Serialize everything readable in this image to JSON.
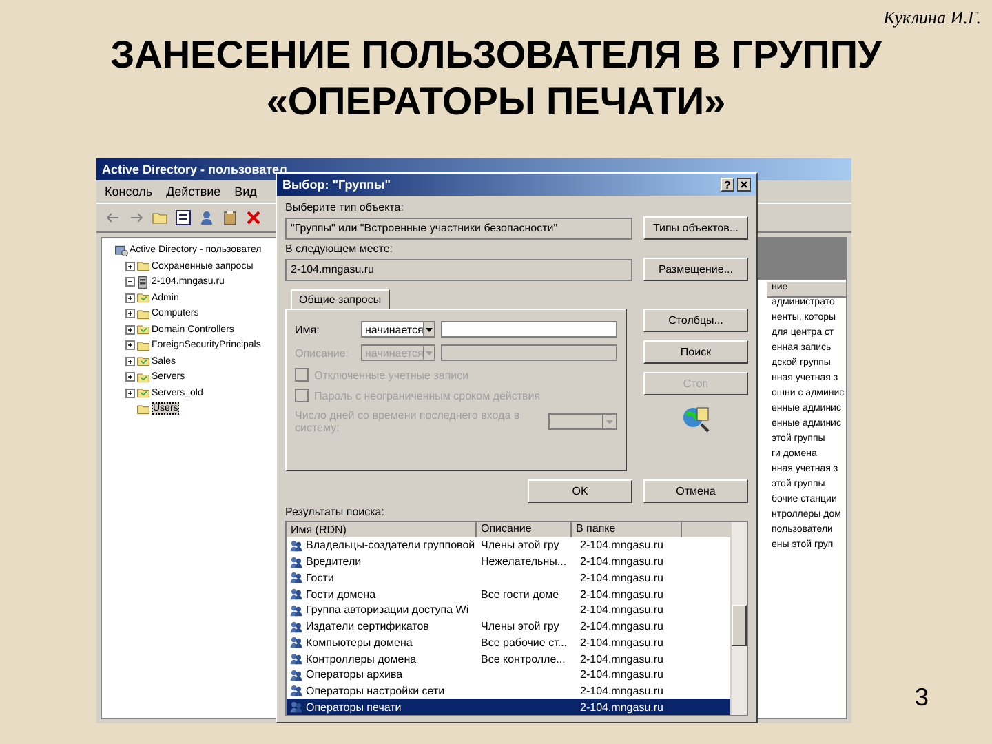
{
  "slide": {
    "author": "Куклина И.Г.",
    "title": "ЗАНЕСЕНИЕ ПОЛЬЗОВАТЕЛЯ В ГРУППУ «ОПЕРАТОРЫ ПЕЧАТИ»",
    "page_number": "3"
  },
  "ad_window": {
    "title": "Active Directory - пользовател",
    "menu": [
      "Консоль",
      "Действие",
      "Вид"
    ],
    "tree": [
      {
        "label": "Active Directory - пользовател",
        "kind": "root",
        "selected": false,
        "children": [
          {
            "label": "Сохраненные запросы",
            "kind": "container",
            "expanded": false,
            "selected": false
          },
          {
            "label": "2-104.mngasu.ru",
            "kind": "domain",
            "expanded": true,
            "selected": false,
            "children": [
              {
                "label": "Admin",
                "kind": "ou",
                "expanded": false,
                "selected": false
              },
              {
                "label": "Computers",
                "kind": "container",
                "expanded": false,
                "selected": false
              },
              {
                "label": "Domain Controllers",
                "kind": "ou",
                "expanded": false,
                "selected": false
              },
              {
                "label": "ForeignSecurityPrincipals",
                "kind": "container",
                "expanded": false,
                "selected": false
              },
              {
                "label": "Sales",
                "kind": "ou",
                "expanded": false,
                "selected": false
              },
              {
                "label": "Servers",
                "kind": "ou",
                "expanded": false,
                "selected": false
              },
              {
                "label": "Servers_old",
                "kind": "ou",
                "expanded": false,
                "selected": false
              },
              {
                "label": "Users",
                "kind": "container",
                "selected": true
              }
            ]
          }
        ]
      }
    ],
    "list_header": "ние",
    "list_lines": [
      "администрато",
      "ненты, которы",
      "для центра ст",
      "енная запись",
      "дской группы",
      "нная учетная з",
      "ошни с админис",
      "енные админис",
      "енные админис",
      "этой группы",
      "ги домена",
      "нная учетная з",
      "этой группы",
      "бочие станции",
      "нтроллеры дом",
      "пользователи",
      "ены этой груп"
    ]
  },
  "dialog": {
    "title": "Выбор: \"Группы\"",
    "help": "?",
    "type_label": "Выберите тип объекта:",
    "type_value": "\"Группы\" или \"Встроенные участники безопасности\"",
    "type_button": "Типы объектов...",
    "location_label": "В следующем месте:",
    "location_value": "2-104.mngasu.ru",
    "location_button": "Размещение...",
    "tab": "Общие запросы",
    "fields": [
      {
        "label": "Имя:",
        "mode": "начинается",
        "disabled": false
      },
      {
        "label": "Описание:",
        "mode": "начинается",
        "disabled": true
      }
    ],
    "checks": [
      {
        "label": "Отключенные учетные записи",
        "checked": false,
        "disabled": true
      },
      {
        "label": "Пароль с неограниченным сроком действия",
        "checked": false,
        "disabled": true
      }
    ],
    "days_label": "Число дней со времени последнего входа в систему:",
    "side_buttons": [
      {
        "label": "Столбцы...",
        "disabled": false
      },
      {
        "label": "Поиск",
        "disabled": false
      },
      {
        "label": "Стоп",
        "disabled": true
      }
    ],
    "ok": "OK",
    "cancel": "Отмена",
    "results_label": "Результаты поиска:",
    "columns": [
      "Имя (RDN)",
      "Описание",
      "В папке"
    ],
    "rows": [
      {
        "name": "Владельцы-создатели групповой",
        "description": "Члены этой гру",
        "folder": "2-104.mngasu.ru",
        "selected": false
      },
      {
        "name": "Вредители",
        "description": "Нежелательны...",
        "folder": "2-104.mngasu.ru",
        "selected": false
      },
      {
        "name": "Гости",
        "description": "",
        "folder": "2-104.mngasu.ru",
        "selected": false
      },
      {
        "name": "Гости домена",
        "description": "Все гости доме",
        "folder": "2-104.mngasu.ru",
        "selected": false
      },
      {
        "name": "Группа авторизации доступа Wi",
        "description": "",
        "folder": "2-104.mngasu.ru",
        "selected": false
      },
      {
        "name": "Издатели сертификатов",
        "description": "Члены этой гру",
        "folder": "2-104.mngasu.ru",
        "selected": false
      },
      {
        "name": "Компьютеры домена",
        "description": "Все рабочие ст...",
        "folder": "2-104.mngasu.ru",
        "selected": false
      },
      {
        "name": "Контроллеры домена",
        "description": "Все контролле...",
        "folder": "2-104.mngasu.ru",
        "selected": false
      },
      {
        "name": "Операторы архива",
        "description": "",
        "folder": "2-104.mngasu.ru",
        "selected": false
      },
      {
        "name": "Операторы настройки сети",
        "description": "",
        "folder": "2-104.mngasu.ru",
        "selected": false
      },
      {
        "name": "Операторы печати",
        "description": "",
        "folder": "2-104.mngasu.ru",
        "selected": true
      }
    ]
  }
}
